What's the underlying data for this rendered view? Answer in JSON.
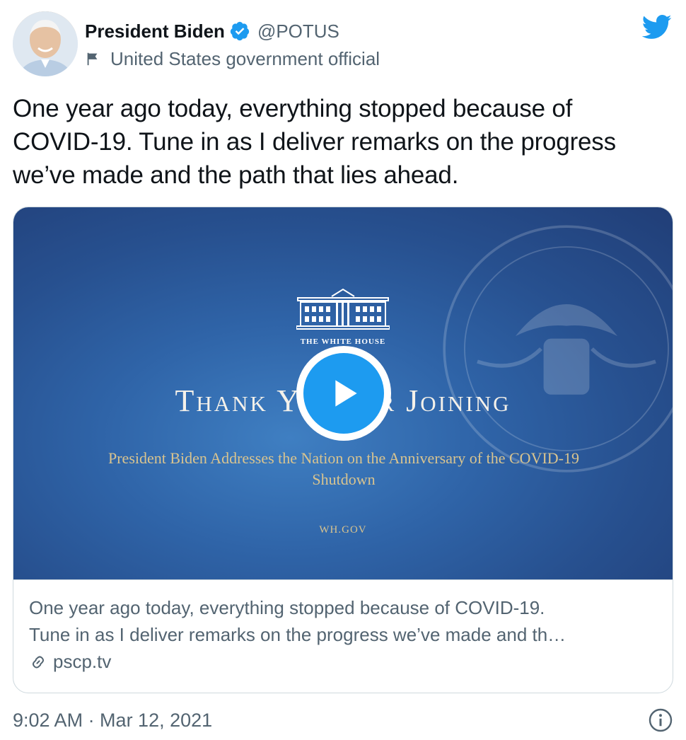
{
  "author": {
    "display_name": "President Biden",
    "handle": "@POTUS",
    "label": "United States government official",
    "avatar_icon": "avatar-photo",
    "verified_icon": "verified-badge-icon"
  },
  "tweet": {
    "text_lines": [
      "One year ago today, everything stopped because of",
      "COVID-19. Tune in as I deliver remarks on the progress",
      "we’ve made and the path that lies ahead."
    ],
    "timestamp": "9:02 AM · Mar 12, 2021"
  },
  "card": {
    "media": {
      "org_caption": "THE WHITE HOUSE",
      "title": "Thank You for Joining",
      "subtitle_line1": "President Biden Addresses the Nation on the Anniversary of the COVID-19",
      "subtitle_line2": "Shutdown",
      "url": "WH.GOV"
    },
    "description_line1": "One year ago today, everything stopped because of COVID-19.",
    "description_line2": "Tune in as I deliver remarks on the progress we’ve made and th…",
    "domain": "pscp.tv"
  },
  "colors": {
    "brand_blue": "#1d9bf0",
    "text_primary": "#0f1419",
    "text_secondary": "#536471",
    "border": "#cfd9de"
  },
  "icons": [
    "twitter-bird-icon",
    "verified-badge-icon",
    "flag-icon",
    "play-icon",
    "link-icon",
    "info-icon"
  ]
}
